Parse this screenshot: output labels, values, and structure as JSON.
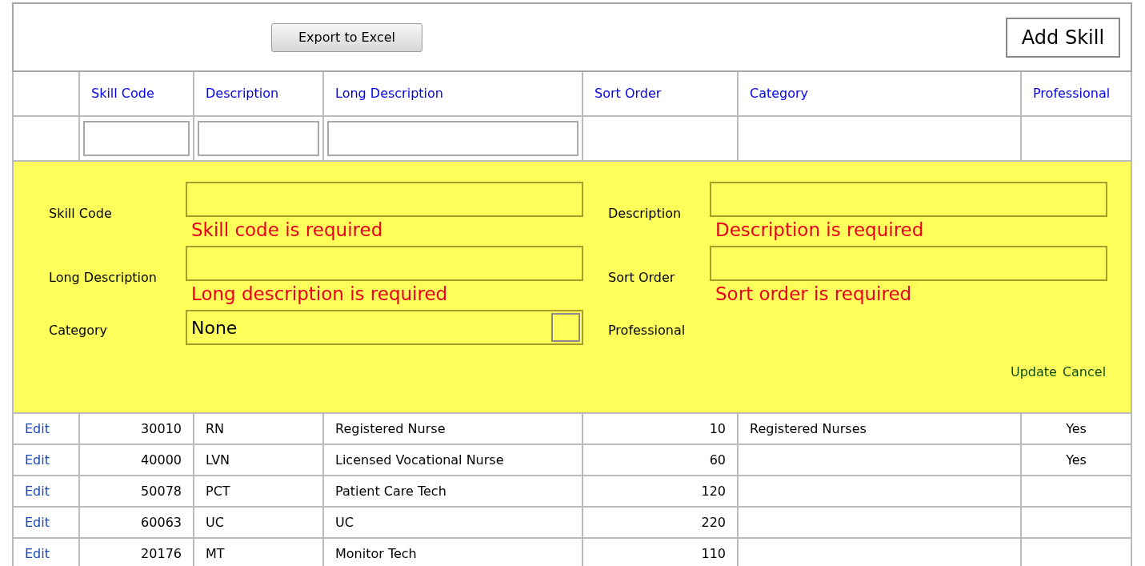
{
  "toolbar": {
    "export_button": "Export to Excel",
    "add_button": "Add Skill"
  },
  "columns": [
    {
      "label": "Skill Code",
      "filter": true
    },
    {
      "label": "Description",
      "filter": true
    },
    {
      "label": "Long Description",
      "filter": true
    },
    {
      "label": "Sort Order",
      "filter": false
    },
    {
      "label": "Category",
      "filter": false
    },
    {
      "label": "Professional",
      "filter": false
    }
  ],
  "edit_form": {
    "fields": [
      {
        "label": "Skill Code",
        "kind": "text",
        "error": "Skill code is required"
      },
      {
        "label": "Description",
        "kind": "text",
        "error": "Description is required"
      },
      {
        "label": "Long Description",
        "kind": "text",
        "error": "Long description is required"
      },
      {
        "label": "Sort Order",
        "kind": "text",
        "error": "Sort order is required"
      },
      {
        "label": "Category",
        "kind": "select",
        "value": "None"
      },
      {
        "label": "Professional",
        "kind": "blank"
      }
    ],
    "actions": [
      "Update",
      "Cancel"
    ]
  },
  "rows": [
    {
      "action": "Edit",
      "cells": [
        "30010",
        "RN",
        "Registered Nurse",
        "10",
        "Registered Nurses",
        "Yes"
      ]
    },
    {
      "action": "Edit",
      "cells": [
        "40000",
        "LVN",
        "Licensed Vocational Nurse",
        "60",
        "",
        "Yes"
      ]
    },
    {
      "action": "Edit",
      "cells": [
        "50078",
        "PCT",
        "Patient Care Tech",
        "120",
        "",
        ""
      ]
    },
    {
      "action": "Edit",
      "cells": [
        "60063",
        "UC",
        "UC",
        "220",
        "",
        ""
      ]
    },
    {
      "action": "Edit",
      "cells": [
        "20176",
        "MT",
        "Monitor Tech",
        "110",
        "",
        ""
      ]
    }
  ]
}
